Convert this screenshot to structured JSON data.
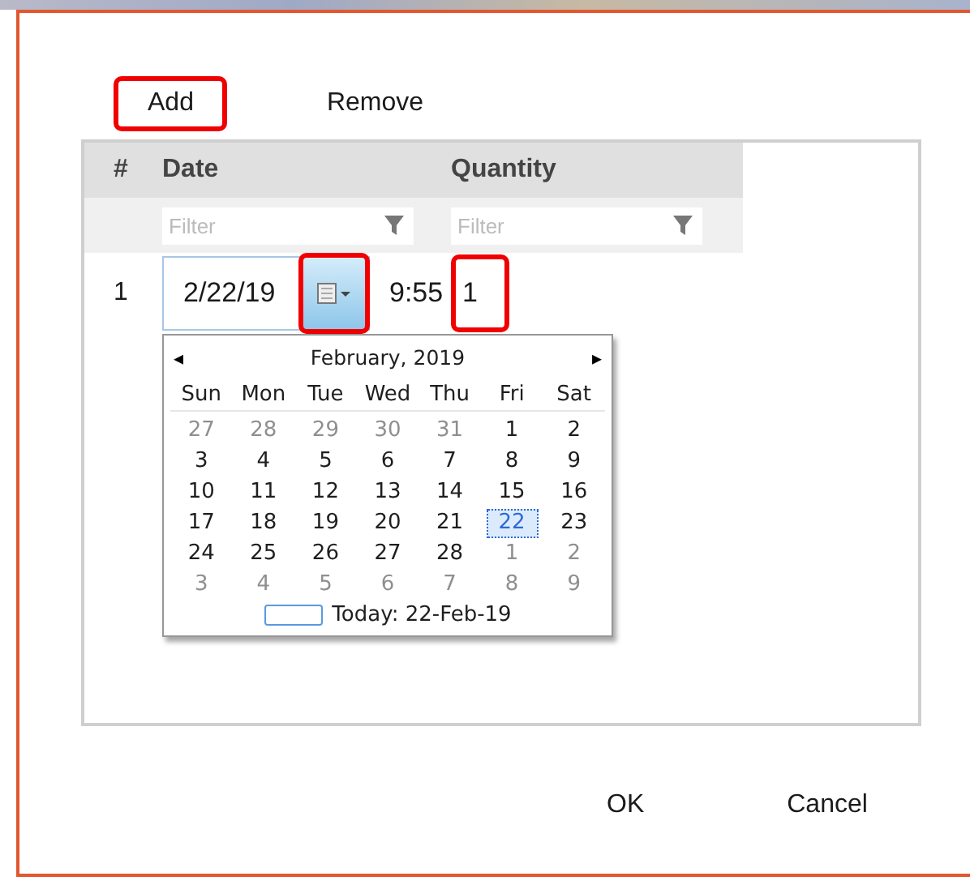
{
  "toolbar": [
    {
      "label": "Add",
      "highlighted": true
    },
    {
      "label": "Remove",
      "highlighted": false
    }
  ],
  "grid": {
    "columns": [
      {
        "label": "#"
      },
      {
        "label": "Date",
        "filter": {
          "placeholder": "Filter"
        }
      },
      {
        "label": "Quantity",
        "filter": {
          "placeholder": "Filter"
        }
      }
    ],
    "rows": [
      {
        "number": "1",
        "date": "2/22/19",
        "time": "9:55",
        "picker_highlighted": true,
        "quantity": "1",
        "quantity_highlighted": true
      }
    ]
  },
  "calendar": {
    "month": "February, 2019",
    "prev": "◂",
    "next": "▸",
    "weekdays": [
      "Sun",
      "Mon",
      "Tue",
      "Wed",
      "Thu",
      "Fri",
      "Sat"
    ],
    "weeks": [
      [
        {
          "day": "27",
          "in_month": false,
          "selected": false
        },
        {
          "day": "28",
          "in_month": false,
          "selected": false
        },
        {
          "day": "29",
          "in_month": false,
          "selected": false
        },
        {
          "day": "30",
          "in_month": false,
          "selected": false
        },
        {
          "day": "31",
          "in_month": false,
          "selected": false
        },
        {
          "day": "1",
          "in_month": true,
          "selected": false
        },
        {
          "day": "2",
          "in_month": true,
          "selected": false
        }
      ],
      [
        {
          "day": "3",
          "in_month": true,
          "selected": false
        },
        {
          "day": "4",
          "in_month": true,
          "selected": false
        },
        {
          "day": "5",
          "in_month": true,
          "selected": false
        },
        {
          "day": "6",
          "in_month": true,
          "selected": false
        },
        {
          "day": "7",
          "in_month": true,
          "selected": false
        },
        {
          "day": "8",
          "in_month": true,
          "selected": false
        },
        {
          "day": "9",
          "in_month": true,
          "selected": false
        }
      ],
      [
        {
          "day": "10",
          "in_month": true,
          "selected": false
        },
        {
          "day": "11",
          "in_month": true,
          "selected": false
        },
        {
          "day": "12",
          "in_month": true,
          "selected": false
        },
        {
          "day": "13",
          "in_month": true,
          "selected": false
        },
        {
          "day": "14",
          "in_month": true,
          "selected": false
        },
        {
          "day": "15",
          "in_month": true,
          "selected": false
        },
        {
          "day": "16",
          "in_month": true,
          "selected": false
        }
      ],
      [
        {
          "day": "17",
          "in_month": true,
          "selected": false
        },
        {
          "day": "18",
          "in_month": true,
          "selected": false
        },
        {
          "day": "19",
          "in_month": true,
          "selected": false
        },
        {
          "day": "20",
          "in_month": true,
          "selected": false
        },
        {
          "day": "21",
          "in_month": true,
          "selected": false
        },
        {
          "day": "22",
          "in_month": true,
          "selected": true
        },
        {
          "day": "23",
          "in_month": true,
          "selected": false
        }
      ],
      [
        {
          "day": "24",
          "in_month": true,
          "selected": false
        },
        {
          "day": "25",
          "in_month": true,
          "selected": false
        },
        {
          "day": "26",
          "in_month": true,
          "selected": false
        },
        {
          "day": "27",
          "in_month": true,
          "selected": false
        },
        {
          "day": "28",
          "in_month": true,
          "selected": false
        },
        {
          "day": "1",
          "in_month": false,
          "selected": false
        },
        {
          "day": "2",
          "in_month": false,
          "selected": false
        }
      ],
      [
        {
          "day": "3",
          "in_month": false,
          "selected": false
        },
        {
          "day": "4",
          "in_month": false,
          "selected": false
        },
        {
          "day": "5",
          "in_month": false,
          "selected": false
        },
        {
          "day": "6",
          "in_month": false,
          "selected": false
        },
        {
          "day": "7",
          "in_month": false,
          "selected": false
        },
        {
          "day": "8",
          "in_month": false,
          "selected": false
        },
        {
          "day": "9",
          "in_month": false,
          "selected": false
        }
      ]
    ],
    "today": "Today: 22-Feb-19"
  },
  "buttons": [
    "OK",
    "Cancel"
  ]
}
